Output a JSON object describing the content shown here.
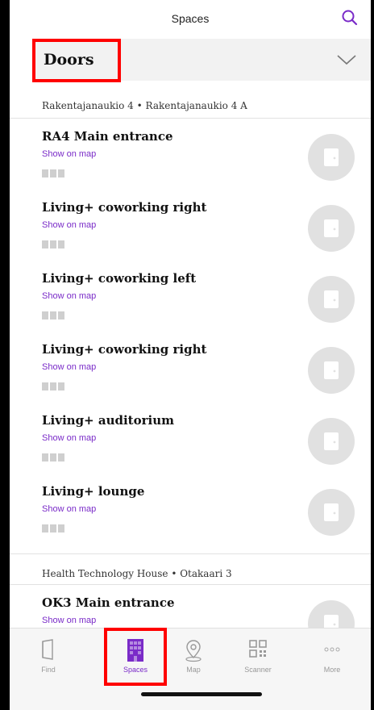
{
  "header": {
    "title": "Spaces"
  },
  "category": {
    "title": "Doors"
  },
  "sections": [
    {
      "label": "Rakentajanaukio 4 • Rakentajanaukio 4 A",
      "items": [
        {
          "title": "RA4 Main entrance",
          "link": "Show on map"
        },
        {
          "title": "Living+ coworking right",
          "link": "Show on map"
        },
        {
          "title": "Living+ coworking left",
          "link": "Show on map"
        },
        {
          "title": "Living+ coworking right",
          "link": "Show on map"
        },
        {
          "title": "Living+ auditorium",
          "link": "Show on map"
        },
        {
          "title": "Living+ lounge",
          "link": "Show on map"
        }
      ]
    },
    {
      "label": "Health Technology House • Otakaari 3",
      "items": [
        {
          "title": "OK3 Main entrance",
          "link": "Show on map"
        }
      ]
    }
  ],
  "tabs": [
    {
      "label": "Find",
      "icon": "door-icon",
      "active": false
    },
    {
      "label": "Spaces",
      "icon": "spaces-icon",
      "active": true
    },
    {
      "label": "Map",
      "icon": "map-pin-icon",
      "active": false
    },
    {
      "label": "Scanner",
      "icon": "qr-icon",
      "active": false
    },
    {
      "label": "More",
      "icon": "more-icon",
      "active": false
    }
  ],
  "colors": {
    "accent": "#7a2bc8",
    "highlight": "#ff0000"
  }
}
